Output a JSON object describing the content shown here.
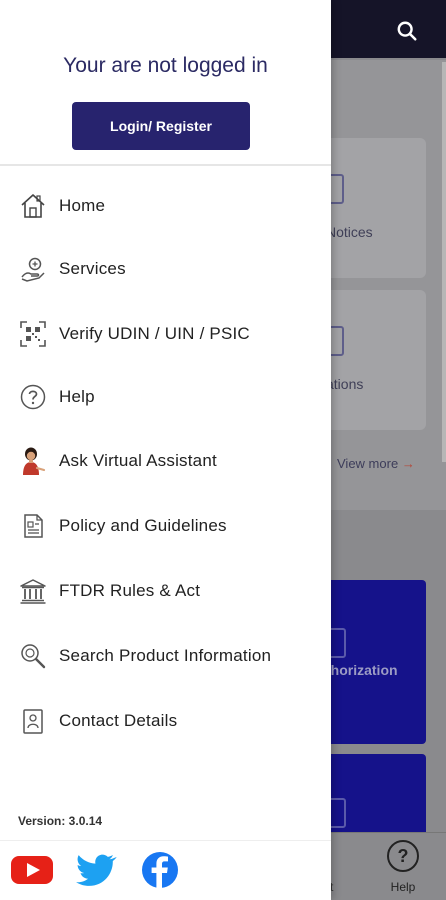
{
  "background": {
    "cards": [
      {
        "label": "Notices"
      },
      {
        "label": "ations"
      }
    ],
    "view_more": "View more",
    "view_more_arrow": "→",
    "auth_card_label": "thorization",
    "bottom_nav": {
      "help_label": "Help",
      "help_glyph": "?",
      "partial_label": "t"
    }
  },
  "drawer": {
    "login_message": "Your are not logged in",
    "login_button": "Login/ Register",
    "menu": [
      {
        "label": "Home",
        "icon": "home-icon"
      },
      {
        "label": "Services",
        "icon": "services-icon"
      },
      {
        "label": "Verify UDIN / UIN / PSIC",
        "icon": "qr-scan-icon"
      },
      {
        "label": "Help",
        "icon": "help-icon"
      },
      {
        "label": "Ask Virtual Assistant",
        "icon": "virtual-assistant-icon"
      },
      {
        "label": "Policy and Guidelines",
        "icon": "policy-document-icon"
      },
      {
        "label": "FTDR Rules & Act",
        "icon": "building-icon"
      },
      {
        "label": "Search Product Information",
        "icon": "search-product-icon"
      },
      {
        "label": "Contact Details",
        "icon": "contact-card-icon"
      }
    ],
    "version": "Version: 3.0.14",
    "social": [
      {
        "name": "youtube",
        "icon": "youtube-icon",
        "color": "#e62117"
      },
      {
        "name": "twitter",
        "icon": "twitter-icon",
        "color": "#1da1f2"
      },
      {
        "name": "facebook",
        "icon": "facebook-icon",
        "color": "#1877f2"
      }
    ]
  },
  "colors": {
    "primary": "#27236e",
    "heading": "#2b2a63",
    "topbar": "#151428"
  }
}
